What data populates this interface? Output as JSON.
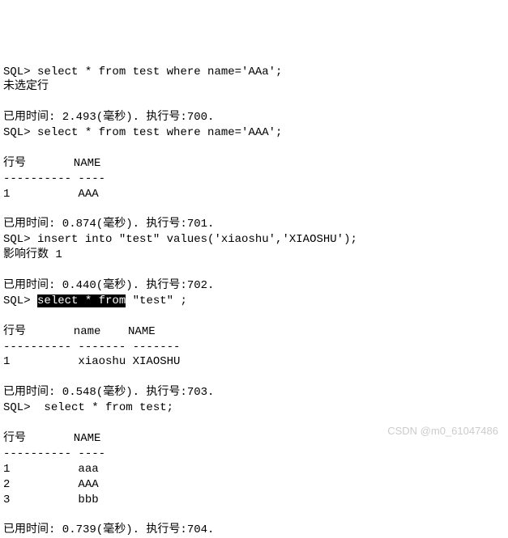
{
  "prompt": "SQL>",
  "blank": "",
  "q1": {
    "sql": " select * from test where name='AAa';",
    "msg": "未选定行",
    "time": "已用时间: 2.493(毫秒). 执行号:700."
  },
  "q2": {
    "sql": " select * from test where name='AAA';",
    "hdr": "行号       NAME",
    "sep": "---------- ----",
    "row": "1          AAA",
    "time": "已用时间: 0.874(毫秒). 执行号:701."
  },
  "q3": {
    "sql": " insert into \"test\" values('xiaoshu','XIAOSHU');",
    "msg": "影响行数 1",
    "time": "已用时间: 0.440(毫秒). 执行号:702."
  },
  "q4": {
    "pre": " ",
    "hl": "select * from",
    "post": " \"test\" ;",
    "hdr": "行号       name    NAME",
    "sep": "---------- ------- -------",
    "row": "1          xiaoshu XIAOSHU",
    "time": "已用时间: 0.548(毫秒). 执行号:703."
  },
  "q5": {
    "sql": "  select * from test;",
    "hdr": "行号       NAME",
    "sep": "---------- ----",
    "r1": "1          aaa",
    "r2": "2          AAA",
    "r3": "3          bbb",
    "time": "已用时间: 0.739(毫秒). 执行号:704."
  },
  "watermark": "CSDN @m0_61047486"
}
